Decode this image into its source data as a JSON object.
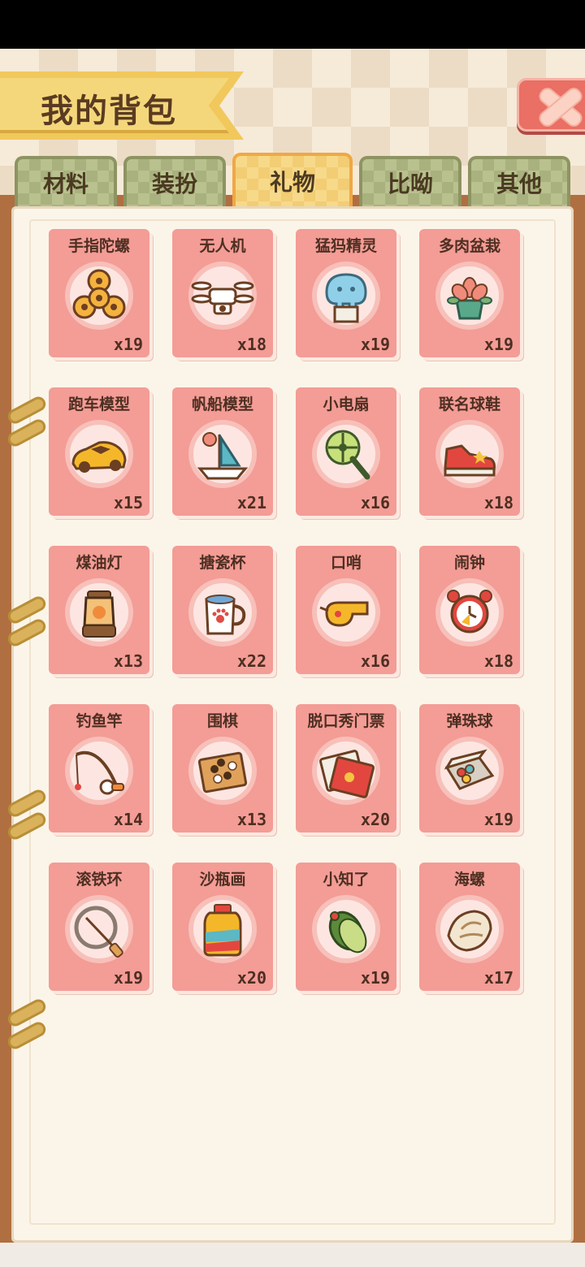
{
  "header": {
    "title": "我的背包"
  },
  "tabs": [
    {
      "label": "材料",
      "active": false
    },
    {
      "label": "装扮",
      "active": false
    },
    {
      "label": "礼物",
      "active": true
    },
    {
      "label": "比呦",
      "active": false
    },
    {
      "label": "其他",
      "active": false
    }
  ],
  "items": [
    {
      "name": "手指陀螺",
      "count": "x19",
      "icon": "fidget-spinner-icon"
    },
    {
      "name": "无人机",
      "count": "x18",
      "icon": "drone-icon"
    },
    {
      "name": "猛犸精灵",
      "count": "x19",
      "icon": "mammoth-spirit-icon"
    },
    {
      "name": "多肉盆栽",
      "count": "x19",
      "icon": "succulent-pot-icon"
    },
    {
      "name": "跑车模型",
      "count": "x15",
      "icon": "sports-car-model-icon"
    },
    {
      "name": "帆船模型",
      "count": "x21",
      "icon": "sailboat-model-icon"
    },
    {
      "name": "小电扇",
      "count": "x16",
      "icon": "small-fan-icon"
    },
    {
      "name": "联名球鞋",
      "count": "x18",
      "icon": "sneaker-icon"
    },
    {
      "name": "煤油灯",
      "count": "x13",
      "icon": "kerosene-lamp-icon"
    },
    {
      "name": "搪瓷杯",
      "count": "x22",
      "icon": "enamel-cup-icon"
    },
    {
      "name": "口哨",
      "count": "x16",
      "icon": "whistle-icon"
    },
    {
      "name": "闹钟",
      "count": "x18",
      "icon": "alarm-clock-icon"
    },
    {
      "name": "钓鱼竿",
      "count": "x14",
      "icon": "fishing-rod-icon"
    },
    {
      "name": "围棋",
      "count": "x13",
      "icon": "go-board-icon"
    },
    {
      "name": "脱口秀门票",
      "count": "x20",
      "icon": "ticket-icon"
    },
    {
      "name": "弹珠球",
      "count": "x19",
      "icon": "marbles-box-icon"
    },
    {
      "name": "滚铁环",
      "count": "x19",
      "icon": "hoop-roll-icon"
    },
    {
      "name": "沙瓶画",
      "count": "x20",
      "icon": "sand-bottle-icon"
    },
    {
      "name": "小知了",
      "count": "x19",
      "icon": "cicada-icon"
    },
    {
      "name": "海螺",
      "count": "x17",
      "icon": "conch-shell-icon"
    }
  ],
  "colors": {
    "card": "#f49c96",
    "active_tab": "#f7d98a",
    "close": "#ea6f64"
  }
}
